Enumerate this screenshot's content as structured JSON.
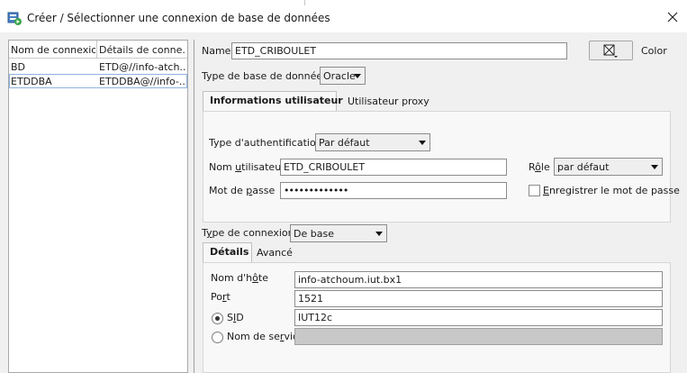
{
  "window": {
    "title": "Créer / Sélectionner une connexion de base de données",
    "close_symbol": "✕"
  },
  "icons": {
    "title": "database-connection-icon",
    "close": "close-icon",
    "color_picker": "color-picker-icon"
  },
  "connection_list": {
    "headers": [
      "Nom de connexion",
      "Détails de conne..."
    ],
    "rows": [
      {
        "name": "BD",
        "details": "ETD@//info-atch..."
      },
      {
        "name": "ETDDBA",
        "details": "ETDDBA@//info-..."
      }
    ]
  },
  "form": {
    "name_label": "Name",
    "name_value": "ETD_CRIBOULET",
    "color_label": "Color",
    "db_type_label": "Type de base de données",
    "db_type_value": "Oracle",
    "user_tabs": [
      "Informations utilisateur",
      "Utilisateur proxy"
    ],
    "auth_type_label": "Type d'authentification",
    "auth_type_value": "Par défaut",
    "username_label_pre": "Nom ",
    "username_label_u": "u",
    "username_label_post": "tilisateur",
    "username_value": "ETD_CRIBOULET",
    "role_label_pre": "R",
    "role_label_u": "ô",
    "role_label_post": "le",
    "role_value": "par défaut",
    "password_label_pre": "Mot de ",
    "password_label_u": "p",
    "password_label_post": "asse",
    "password_value": "•••••••••••••",
    "save_password_label_u": "E",
    "save_password_label_post": "nregistrer le mot de passe",
    "connection_type_label_pre": "T",
    "connection_type_label_u": "y",
    "connection_type_label_post": "pe de connexion",
    "connection_type_value": "De base",
    "detail_tabs": [
      "Détails",
      "Avancé"
    ],
    "host_label_pre": "Nom d'h",
    "host_label_u": "ô",
    "host_label_post": "te",
    "host_value": "info-atchoum.iut.bx1",
    "port_label_pre": "Po",
    "port_label_u": "r",
    "port_label_post": "t",
    "port_value": "1521",
    "sid_label_pre": "S",
    "sid_label_u": "I",
    "sid_label_post": "D",
    "sid_value": "IUT12c",
    "service_label_pre": "Nom de se",
    "service_label_u": "r",
    "service_label_post": "vice",
    "service_value": ""
  }
}
